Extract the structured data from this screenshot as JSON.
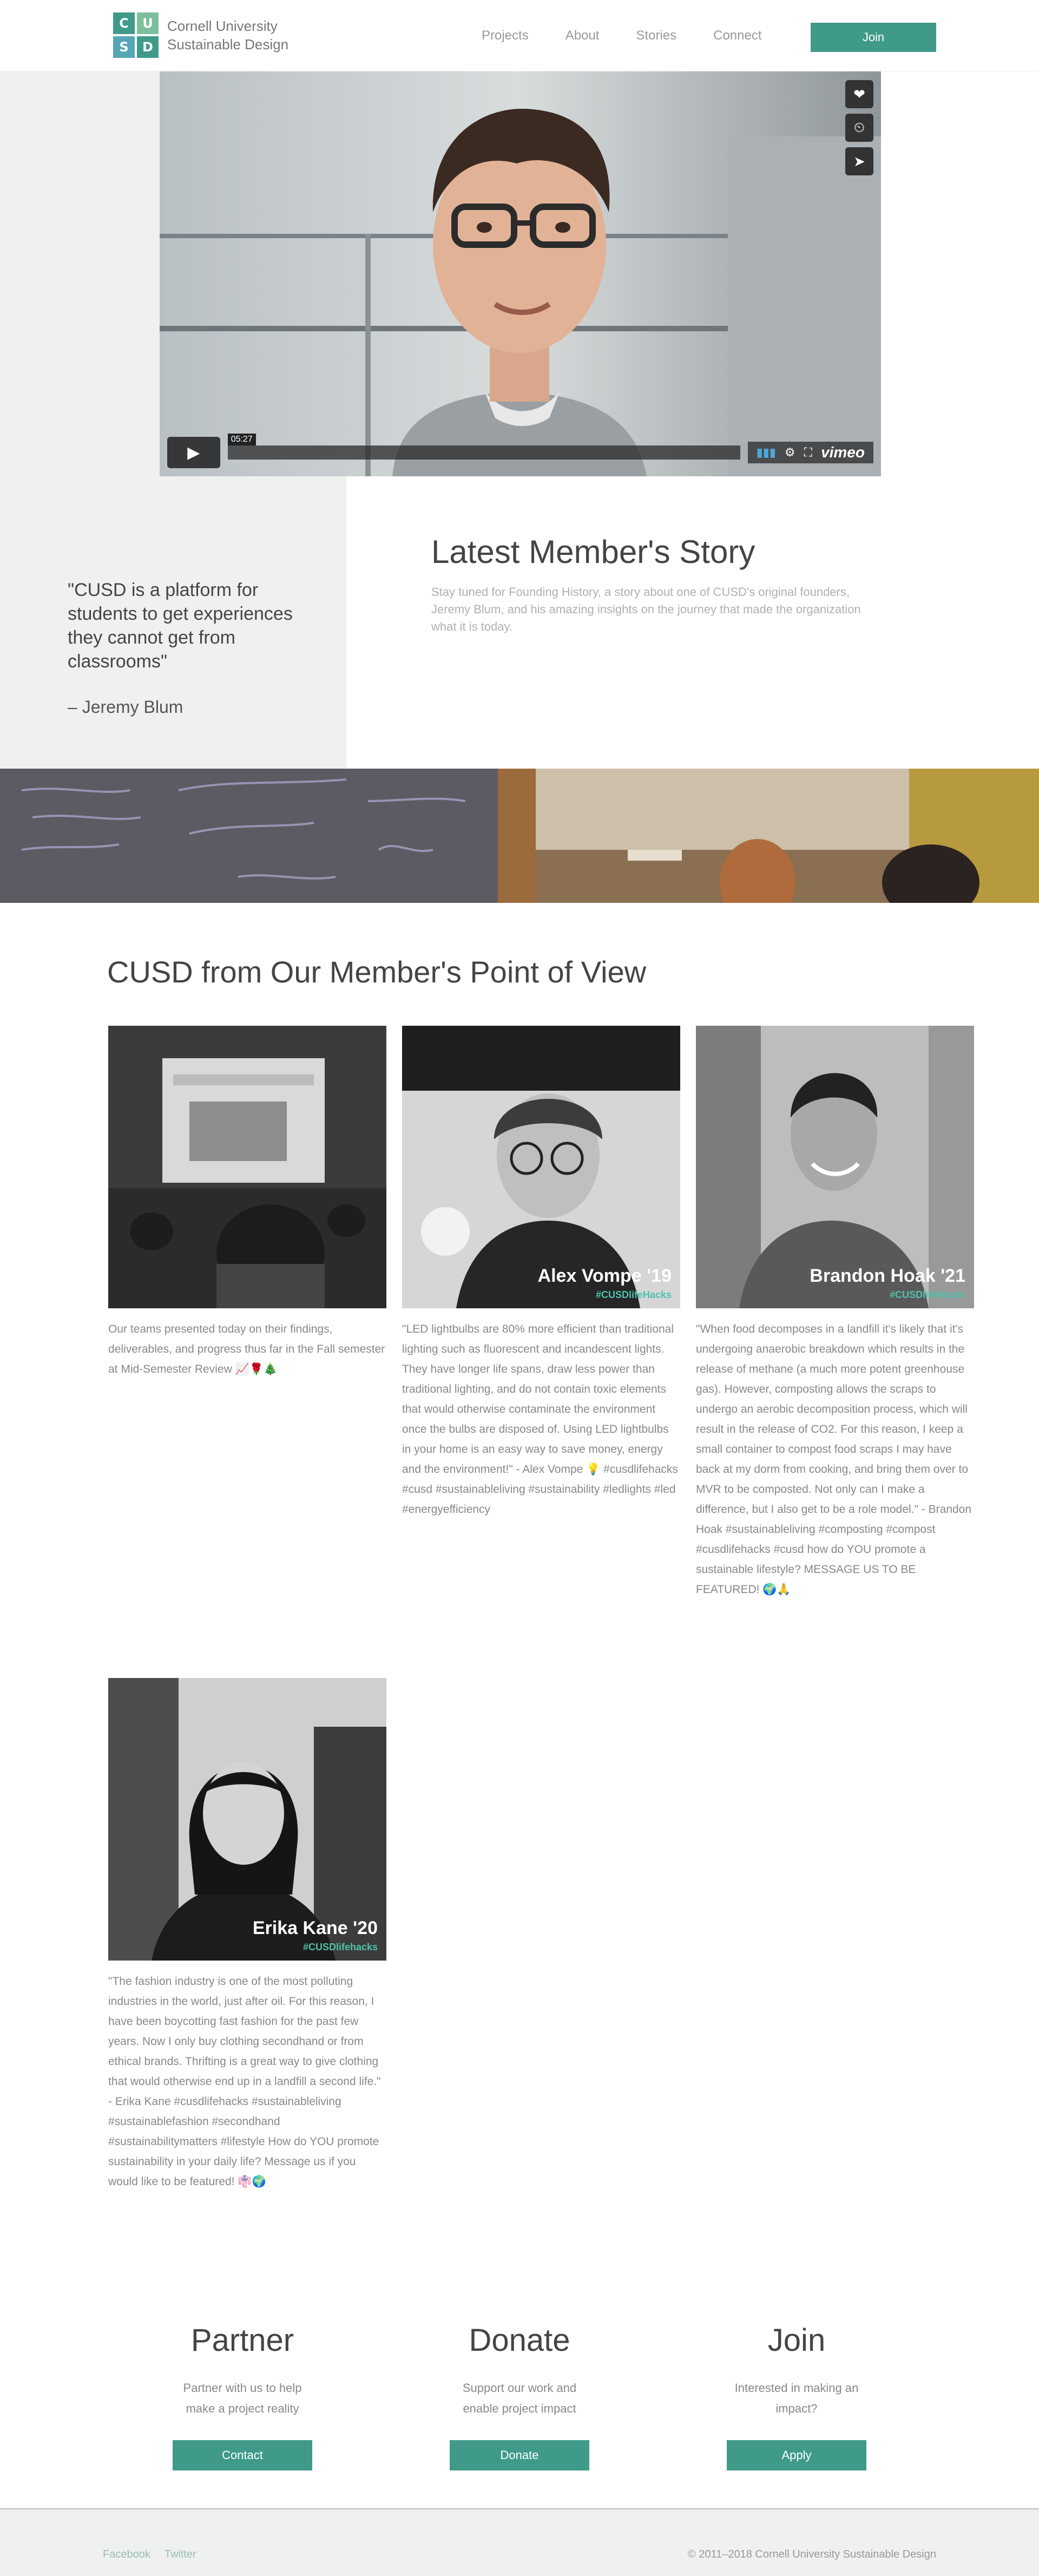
{
  "header": {
    "logo_letters": [
      "C",
      "U",
      "S",
      "D"
    ],
    "logo_colors": [
      "#3f9a8a",
      "#7dbf9b",
      "#56a7b5",
      "#3f9a8a"
    ],
    "logo_line1": "Cornell University",
    "logo_line2": "Sustainable Design",
    "nav": [
      "Projects",
      "About",
      "Stories",
      "Connect"
    ],
    "join_label": "Join"
  },
  "video": {
    "timecode": "05:27",
    "brand": "vimeo",
    "side_icons": [
      "heart-icon",
      "clock-icon",
      "send-icon"
    ]
  },
  "story": {
    "quote": "\"CUSD is a platform for students to get experiences they cannot get from classrooms\"",
    "author": "– Jeremy Blum",
    "title": "Latest Member's Story",
    "text": "Stay tuned for Founding History, a story about one of CUSD's original founders, Jeremy Blum, and his amazing insights on the journey that made the organization what it is today."
  },
  "members_section": {
    "title": "CUSD from Our Member's Point of View",
    "members": [
      {
        "name": "",
        "tag": "",
        "text": "Our teams presented today on their findings, deliverables, and progress thus far in the Fall semester at Mid-Semester Review 📈🌹🎄"
      },
      {
        "name": "Alex Vompe '19",
        "tag": "#CUSDlifeHacks",
        "text": "\"LED lightbulbs are 80% more efficient than traditional lighting such as fluorescent and incandescent lights. They have longer life spans, draw less power than traditional lighting, and do not contain toxic elements that would otherwise contaminate the environment once the bulbs are disposed of. Using LED lightbulbs in your home is an easy way to save money, energy and the environment!\" - Alex Vompe 💡 #cusdlifehacks #cusd #sustainableliving #sustainability #ledlights #led #energyefficiency"
      },
      {
        "name": "Brandon Hoak '21",
        "tag": "#CUSDlifeHacks",
        "text": "\"When food decomposes in a landfill it's likely that it's undergoing anaerobic breakdown which results in the release of methane (a much more potent greenhouse gas). However, composting allows the scraps to undergo an aerobic decomposition process, which will result in the release of CO2. For this reason, I keep a small container to compost food scraps I may have back at my dorm from cooking, and bring them over to MVR to be composted. Not only can I make a difference, but I also get to be a role model.\" - Brandon Hoak #sustainableliving #composting #compost #cusdlifehacks #cusd how do YOU promote a sustainable lifestyle? MESSAGE US TO BE FEATURED! 🌍🙏"
      },
      {
        "name": "Erika Kane '20",
        "tag": "#CUSDlifehacks",
        "text": "\"The fashion industry is one of the most polluting industries in the world, just after oil. For this reason, I have been boycotting fast fashion for the past few years. Now I only buy clothing secondhand or from ethical brands. Thrifting is a great way to give clothing that would otherwise end up in a landfill a second life.\" - Erika Kane #cusdlifehacks #sustainableliving #sustainablefashion #secondhand #sustainabilitymatters #lifestyle How do YOU promote sustainability in your daily life? Message us if you would like to be featured! 👘🌍"
      }
    ]
  },
  "ctas": [
    {
      "title": "Partner",
      "text": "Partner with us to help make a project reality",
      "button": "Contact"
    },
    {
      "title": "Donate",
      "text": "Support our work and enable project impact",
      "button": "Donate"
    },
    {
      "title": "Join",
      "text": "Interested in making an impact?",
      "button": "Apply"
    }
  ],
  "footer": {
    "links": [
      "Facebook",
      "Twitter"
    ],
    "copyright": "© 2011–2018 Cornell University Sustainable Design"
  }
}
